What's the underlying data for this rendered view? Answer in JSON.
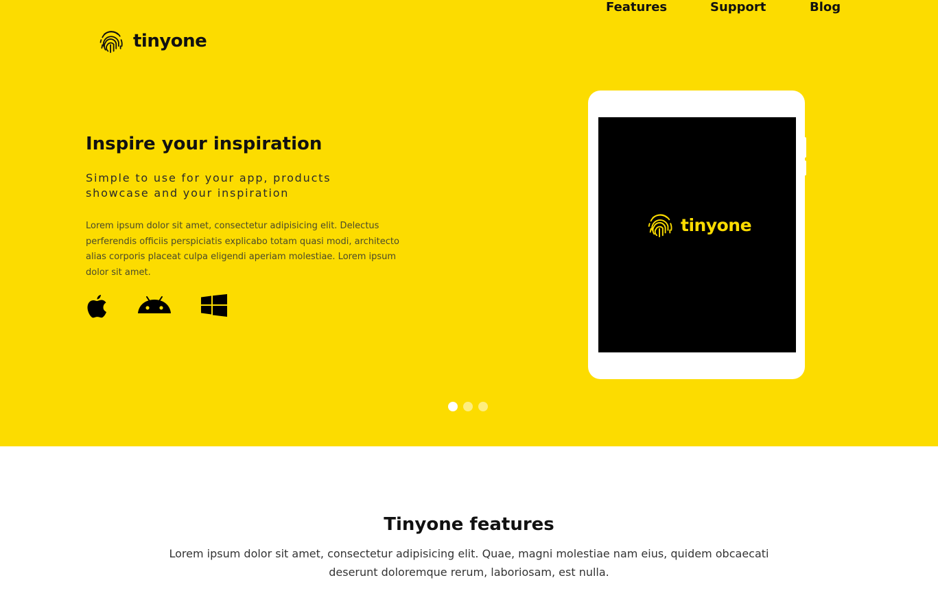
{
  "brand": {
    "name": "tinyone",
    "logo_icon": "fingerprint-icon",
    "primary_color": "#fcdc00",
    "text_color": "#111111"
  },
  "nav": {
    "items": [
      {
        "label": "Features"
      },
      {
        "label": "Support"
      },
      {
        "label": "Blog"
      }
    ]
  },
  "hero": {
    "title": "Inspire your inspiration",
    "subtitle": "Simple to use for your app, products showcase and your inspiration",
    "description": "Lorem ipsum dolor sit amet, consectetur adipisicing elit. Delectus perferendis officiis perspiciatis explicabo totam quasi modi, architecto alias corporis placeat culpa eligendi aperiam molestiae. Lorem ipsum dolor sit amet.",
    "platforms": [
      {
        "icon": "apple-icon"
      },
      {
        "icon": "android-icon"
      },
      {
        "icon": "windows-icon"
      }
    ],
    "device": {
      "type": "tablet",
      "screen_brand": "tinyone"
    },
    "carousel": {
      "total_slides": 3,
      "active_index": 0
    }
  },
  "features": {
    "title": "Tinyone features",
    "description": "Lorem ipsum dolor sit amet, consectetur adipisicing elit. Quae, magni molestiae nam eius, quidem obcaecati deserunt doloremque rerum, laboriosam, est nulla."
  }
}
